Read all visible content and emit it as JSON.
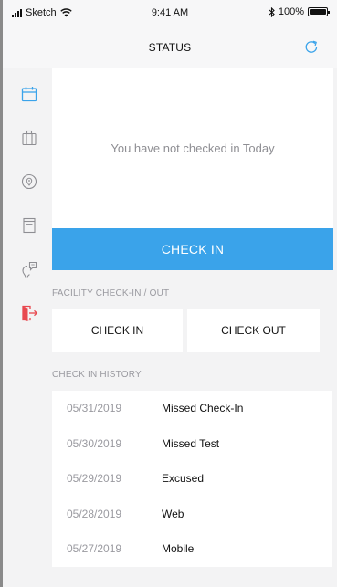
{
  "statusbar": {
    "carrier": "Sketch",
    "time": "9:41 AM",
    "battery": "100%"
  },
  "nav": {
    "title": "STATUS"
  },
  "rail": {
    "icons": [
      "calendar-icon",
      "luggage-icon",
      "location-pin-icon",
      "document-icon",
      "voice-assistant-icon",
      "sign-out-icon"
    ],
    "active_color": "#3aa3ea",
    "signout_color": "#e8484f"
  },
  "status": {
    "message": "You have not checked in Today"
  },
  "main_button": {
    "label": "CHECK IN",
    "color": "#3aa3ea"
  },
  "facility": {
    "section_label": "FACILITY CHECK-IN / OUT",
    "check_in_label": "CHECK IN",
    "check_out_label": "CHECK OUT"
  },
  "history": {
    "section_label": "CHECK IN HISTORY",
    "rows": [
      {
        "date": "05/31/2019",
        "type": "Missed Check-In"
      },
      {
        "date": "05/30/2019",
        "type": "Missed Test"
      },
      {
        "date": "05/29/2019",
        "type": "Excused"
      },
      {
        "date": "05/28/2019",
        "type": "Web"
      },
      {
        "date": "05/27/2019",
        "type": "Mobile"
      }
    ]
  }
}
